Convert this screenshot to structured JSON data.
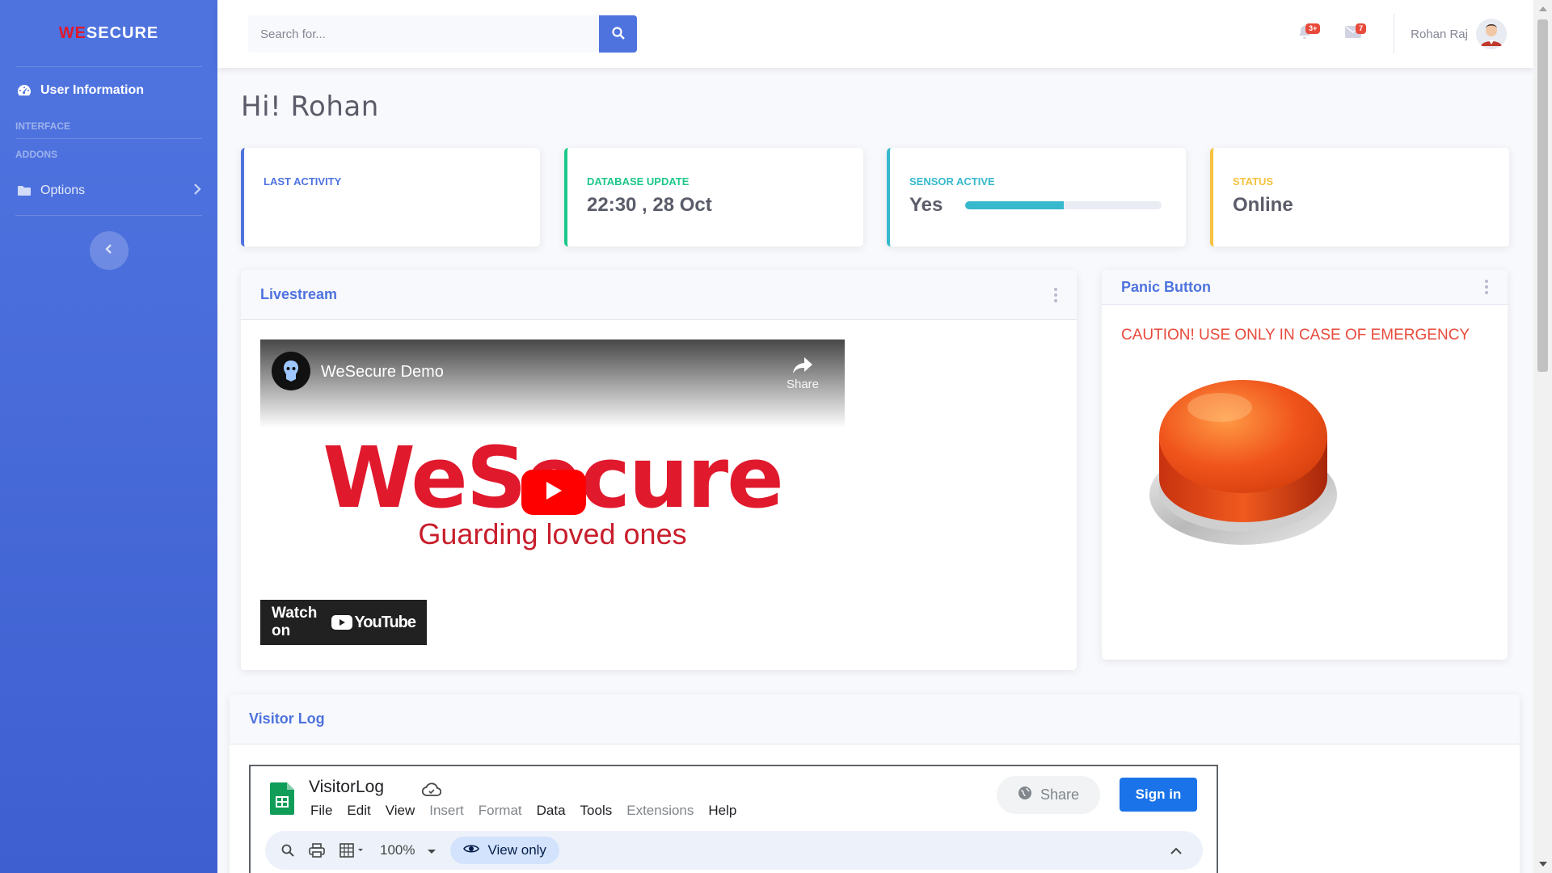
{
  "brand": {
    "part1": "WE",
    "part2": "SECURE"
  },
  "sidebar": {
    "active_item": "User Information",
    "heading_interface": "INTERFACE",
    "heading_addons": "ADDONS",
    "options_label": "Options"
  },
  "search": {
    "placeholder": "Search for..."
  },
  "topbar": {
    "alerts_badge": "3+",
    "messages_badge": "7",
    "user_name": "Rohan Raj"
  },
  "greeting": "Hi! Rohan",
  "stats": [
    {
      "label": "LAST ACTIVITY",
      "value": "",
      "color": "#4e73df"
    },
    {
      "label": "DATABASE UPDATE",
      "value": "22:30 , 28 Oct",
      "color": "#1cc88a"
    },
    {
      "label": "SENSOR ACTIVE",
      "value": "Yes",
      "color": "#36b9cc",
      "progress": 0.5
    },
    {
      "label": "STATUS",
      "value": "Online",
      "color": "#f6c23e"
    }
  ],
  "livestream": {
    "title": "Livestream",
    "video_title": "WeSecure Demo",
    "share_label": "Share",
    "wordmark": "WeSecure",
    "tagline": "Guarding loved ones",
    "watch_on": "Watch on",
    "youtube": "YouTube"
  },
  "panic": {
    "title": "Panic Button",
    "caution": "CAUTION! USE ONLY IN CASE OF EMERGENCY"
  },
  "visitor_log": {
    "title": "Visitor Log",
    "sheet_title": "VisitorLog",
    "menu": [
      "File",
      "Edit",
      "View",
      "Insert",
      "Format",
      "Data",
      "Tools",
      "Extensions",
      "Help"
    ],
    "menu_disabled": [
      "Insert",
      "Format",
      "Extensions"
    ],
    "share_label": "Share",
    "signin_label": "Sign in",
    "zoom": "100%",
    "view_only": "View only"
  }
}
